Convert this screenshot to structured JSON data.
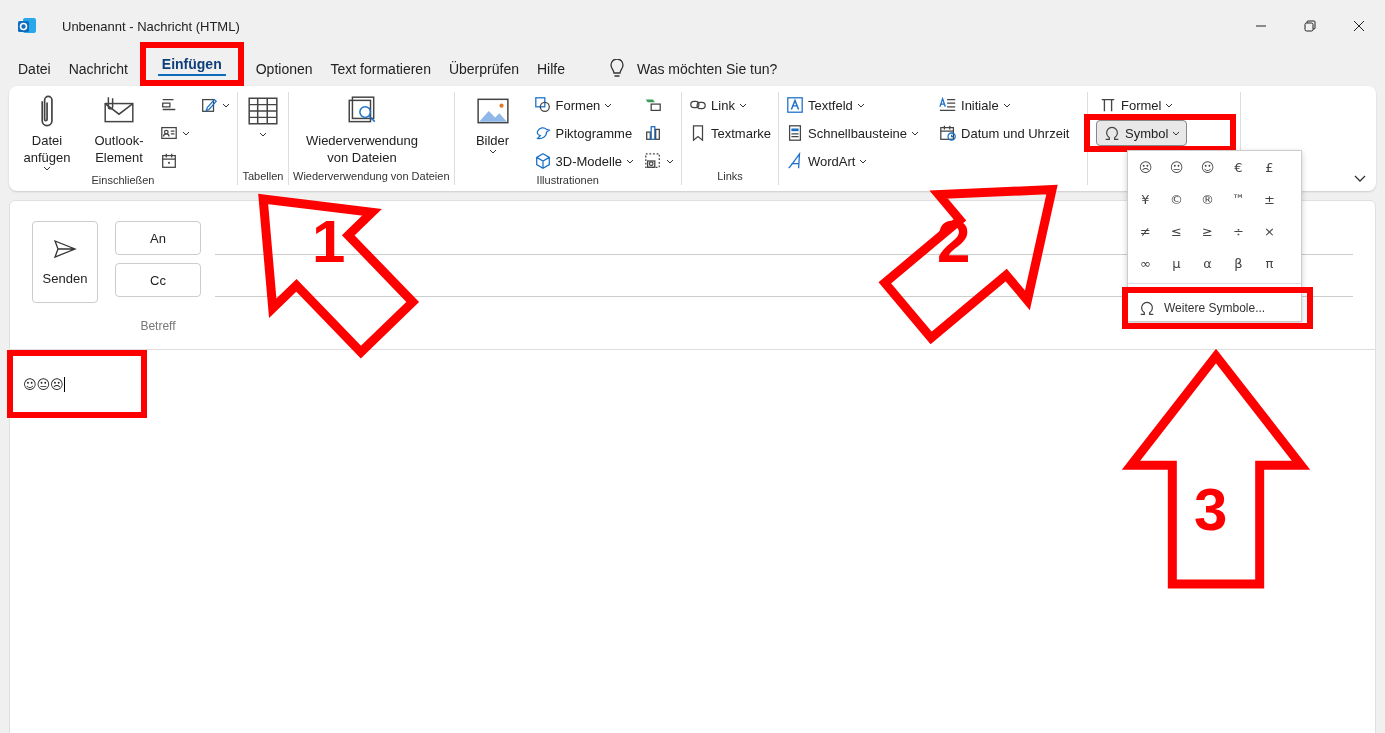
{
  "window": {
    "title": "Unbenannt  -  Nachricht (HTML)"
  },
  "menu_tabs": [
    {
      "label": "Datei",
      "selected": false
    },
    {
      "label": "Nachricht",
      "selected": false
    },
    {
      "label": "Einfügen",
      "selected": true
    },
    {
      "label": "Optionen",
      "selected": false
    },
    {
      "label": "Text formatieren",
      "selected": false
    },
    {
      "label": "Überprüfen",
      "selected": false
    },
    {
      "label": "Hilfe",
      "selected": false
    }
  ],
  "search_prompt": "Was möchten Sie tun?",
  "ribbon_groups": [
    {
      "label": "Einschließen",
      "columns": [
        [
          {
            "kind": "large",
            "label": "Datei anfügen",
            "dropdown": true
          }
        ],
        [
          {
            "kind": "large",
            "label": "Outlook-Element",
            "dropdown": false
          }
        ],
        [
          {
            "kind": "icon",
            "dropdown": false
          },
          {
            "kind": "icon",
            "dropdown": true
          },
          {
            "kind": "icon",
            "dropdown": false
          }
        ],
        [
          {
            "kind": "icon",
            "dropdown": true
          }
        ]
      ]
    },
    {
      "label": "Tabellen",
      "columns": [
        [
          {
            "kind": "large",
            "dropdown": true
          }
        ]
      ]
    },
    {
      "label": "Wiederverwendung von Dateien",
      "columns": [
        [
          {
            "kind": "large",
            "label": "Wiederverwendung von Dateien",
            "dropdown": false
          }
        ]
      ]
    },
    {
      "label": "Illustrationen",
      "columns": [
        [
          {
            "kind": "large",
            "label": "Bilder",
            "dropdown": true
          }
        ],
        [
          {
            "kind": "small",
            "label": "Formen",
            "dropdown": true
          },
          {
            "kind": "small",
            "label": "Piktogramme",
            "dropdown": false
          },
          {
            "kind": "small",
            "label": "3D-Modelle",
            "dropdown": true
          }
        ],
        [
          {
            "kind": "icon",
            "dropdown": false
          },
          {
            "kind": "icon",
            "dropdown": false
          },
          {
            "kind": "icon",
            "dropdown": true
          }
        ]
      ]
    },
    {
      "label": "Links",
      "columns": [
        [
          {
            "kind": "small",
            "label": "Link",
            "dropdown": true
          },
          {
            "kind": "small",
            "label": "Textmarke",
            "dropdown": false
          }
        ]
      ]
    },
    {
      "columns": [
        [
          {
            "kind": "small",
            "label": "Textfeld",
            "dropdown": true
          },
          {
            "kind": "small",
            "label": "Schnellbausteine",
            "dropdown": true
          },
          {
            "kind": "small",
            "label": "WordArt",
            "dropdown": true
          }
        ],
        [
          {
            "kind": "small",
            "label": "Initiale",
            "dropdown": true
          },
          {
            "kind": "small",
            "label": "Datum und Uhrzeit",
            "dropdown": false
          }
        ]
      ]
    }
  ],
  "symbols_group": {
    "formula_label": "Formel",
    "symbol_button": {
      "label": "Symbol",
      "expanded": true
    },
    "symbols": [
      "☹",
      "😐",
      "☺",
      "€",
      "£",
      "¥",
      "©",
      "®",
      "™",
      "±",
      "≠",
      "≤",
      "≥",
      "÷",
      "×",
      "∞",
      "µ",
      "α",
      "β",
      "π"
    ],
    "more_label": "Weitere Symbole..."
  },
  "message": {
    "send_label": "Senden",
    "to_label": "An",
    "cc_label": "Cc",
    "subject_label": "Betreff",
    "body": "☺😐☹"
  },
  "callouts": [
    {
      "number": "1"
    },
    {
      "number": "2"
    },
    {
      "number": "3"
    }
  ]
}
